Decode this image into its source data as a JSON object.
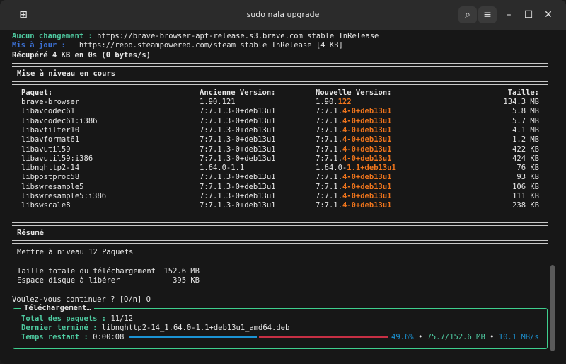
{
  "window": {
    "title": "sudo nala upgrade",
    "icons": {
      "new_tab": "new-tab-icon",
      "search": "search-icon",
      "menu": "hamburger-icon",
      "minimize": "minimize-icon",
      "maximize": "maximize-icon",
      "close": "close-icon"
    },
    "glyphs": {
      "new_tab": "⊞",
      "search": "⌕",
      "menu": "≡",
      "minimize": "–",
      "maximize": "☐",
      "close": "✕"
    }
  },
  "colors": {
    "green": "#4ec9a0",
    "blue": "#3b6fd1",
    "orange": "#f0751c",
    "progress_blue": "#1b93d4",
    "progress_red": "#c72f44",
    "box_border": "#3fcf8e"
  },
  "log": [
    {
      "label": "Aucun changement :",
      "text": " https://brave-browser-apt-release.s3.brave.com stable InRelease"
    },
    {
      "label": "Mis à jour :",
      "text": "   https://repo.steampowered.com/steam stable InRelease [4 KB]"
    },
    {
      "label": "",
      "text": "Récupéré 4 KB en 0s (0 bytes/s)"
    }
  ],
  "rule": "======================================================================================================",
  "upgrade": {
    "heading": "Mise à niveau en cours",
    "headers": {
      "package": "Paquet:",
      "old": "Ancienne Version:",
      "new": "Nouvelle Version:",
      "size": "Taille:"
    },
    "rows": [
      {
        "package": "brave-browser",
        "old": "1.90.121",
        "new_base": "1.90.",
        "new_diff": "122",
        "size": "134.3 MB"
      },
      {
        "package": "libavcodec61",
        "old": "7:7.1.3-0+deb13u1",
        "new_base": "7:7.1.",
        "new_diff": "4-0+deb13u1",
        "size": "5.8 MB"
      },
      {
        "package": "libavcodec61:i386",
        "old": "7:7.1.3-0+deb13u1",
        "new_base": "7:7.1.",
        "new_diff": "4-0+deb13u1",
        "size": "5.7 MB"
      },
      {
        "package": "libavfilter10",
        "old": "7:7.1.3-0+deb13u1",
        "new_base": "7:7.1.",
        "new_diff": "4-0+deb13u1",
        "size": "4.1 MB"
      },
      {
        "package": "libavformat61",
        "old": "7:7.1.3-0+deb13u1",
        "new_base": "7:7.1.",
        "new_diff": "4-0+deb13u1",
        "size": "1.2 MB"
      },
      {
        "package": "libavutil59",
        "old": "7:7.1.3-0+deb13u1",
        "new_base": "7:7.1.",
        "new_diff": "4-0+deb13u1",
        "size": "422 KB"
      },
      {
        "package": "libavutil59:i386",
        "old": "7:7.1.3-0+deb13u1",
        "new_base": "7:7.1.",
        "new_diff": "4-0+deb13u1",
        "size": "424 KB"
      },
      {
        "package": "libnghttp2-14",
        "old": "1.64.0-1.1",
        "new_base": "1.64.0-",
        "new_diff": "1.1+deb13u1",
        "size": "76 KB"
      },
      {
        "package": "libpostproc58",
        "old": "7:7.1.3-0+deb13u1",
        "new_base": "7:7.1.",
        "new_diff": "4-0+deb13u1",
        "size": "93 KB"
      },
      {
        "package": "libswresample5",
        "old": "7:7.1.3-0+deb13u1",
        "new_base": "7:7.1.",
        "new_diff": "4-0+deb13u1",
        "size": "106 KB"
      },
      {
        "package": "libswresample5:i386",
        "old": "7:7.1.3-0+deb13u1",
        "new_base": "7:7.1.",
        "new_diff": "4-0+deb13u1",
        "size": "111 KB"
      },
      {
        "package": "libswscale8",
        "old": "7:7.1.3-0+deb13u1",
        "new_base": "7:7.1.",
        "new_diff": "4-0+deb13u1",
        "size": "238 KB"
      }
    ]
  },
  "summary": {
    "heading": "Résumé",
    "upgrade_line": "Mettre à niveau 12 Paquets",
    "download_label": "Taille totale du téléchargement",
    "download_value": "152.6 MB",
    "disk_label": "Espace disque à libérer",
    "disk_value": "395 KB"
  },
  "prompt": "Voulez-vous continuer ? [O/n] O",
  "download": {
    "title": "Téléchargement…",
    "total_label": "Total des paquets :",
    "total_value": "11/12",
    "last_label": "Dernier terminé :",
    "last_value": "libnghttp2-14_1.64.0-1.1+deb13u1_amd64.deb",
    "time_label": "Temps restant :",
    "time_value": "0:00:08",
    "progress": 0.496,
    "percent": "49.6%",
    "amount": "75.7/152.6 MB",
    "speed": "10.1 MB/s",
    "separator": "•"
  }
}
